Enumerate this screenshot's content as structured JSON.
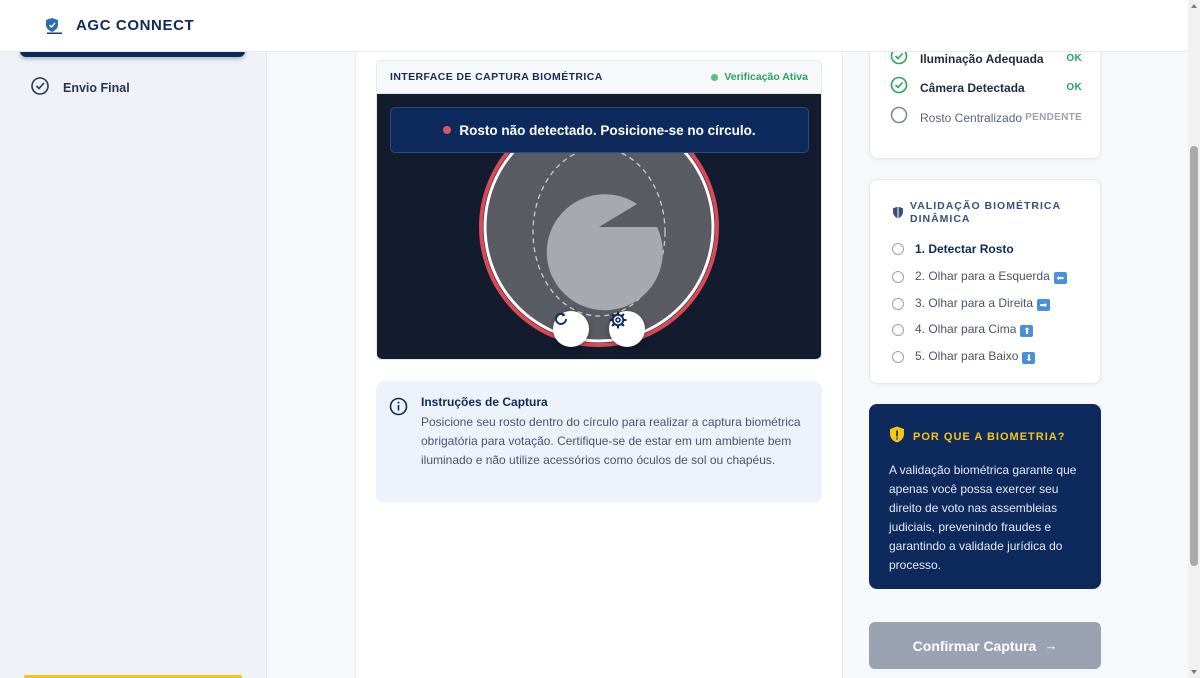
{
  "header": {
    "brand": "AGC CONNECT",
    "logo_icon": "shield-logo-icon"
  },
  "sidebar": {
    "steps": [
      {
        "label": "Envio Final",
        "icon": "check-circle-icon"
      }
    ]
  },
  "capture": {
    "title": "INTERFACE DE CAPTURA BIOMÉTRICA",
    "status": "Verificação Ativa",
    "alert": "Rosto não detectado. Posicione-se no círculo.",
    "controls": [
      "refresh-icon",
      "gear-icon"
    ]
  },
  "instructions": {
    "title": "Instruções de Captura",
    "text": "Posicione seu rosto dentro do círculo para realizar a captura biométrica obrigatória para votação. Certifique-se de estar em um ambiente bem iluminado e não utilize acessórios como óculos de sol ou chapéus."
  },
  "checks": [
    {
      "label": "Iluminação Adequada",
      "status": "OK",
      "done": true
    },
    {
      "label": "Câmera Detectada",
      "status": "OK",
      "done": true
    },
    {
      "label": "Rosto Centralizado",
      "status": "PENDENTE",
      "done": false
    }
  ],
  "biometric": {
    "title": "VALIDAÇÃO BIOMÉTRICA DINÂMICA",
    "steps": [
      {
        "label": "1. Detectar Rosto",
        "arrow": ""
      },
      {
        "label": "2. Olhar para a Esquerda",
        "arrow": "⬅"
      },
      {
        "label": "3. Olhar para a Direita",
        "arrow": "➡"
      },
      {
        "label": "4. Olhar para Cima",
        "arrow": "⬆"
      },
      {
        "label": "5. Olhar para Baixo",
        "arrow": "⬇"
      }
    ]
  },
  "why": {
    "title": "POR QUE A BIOMETRIA?",
    "text": "A validação biométrica garante que apenas você possa exercer seu direito de voto nas assembleias judiciais, prevenindo fraudes e garantindo a validade jurídica do processo."
  },
  "confirm": {
    "label": "Confirmar Captura",
    "arrow": "→"
  },
  "colors": {
    "navy": "#0e2a5c",
    "success": "#28a55a",
    "alert": "#e05563",
    "gold": "#f5c518"
  }
}
